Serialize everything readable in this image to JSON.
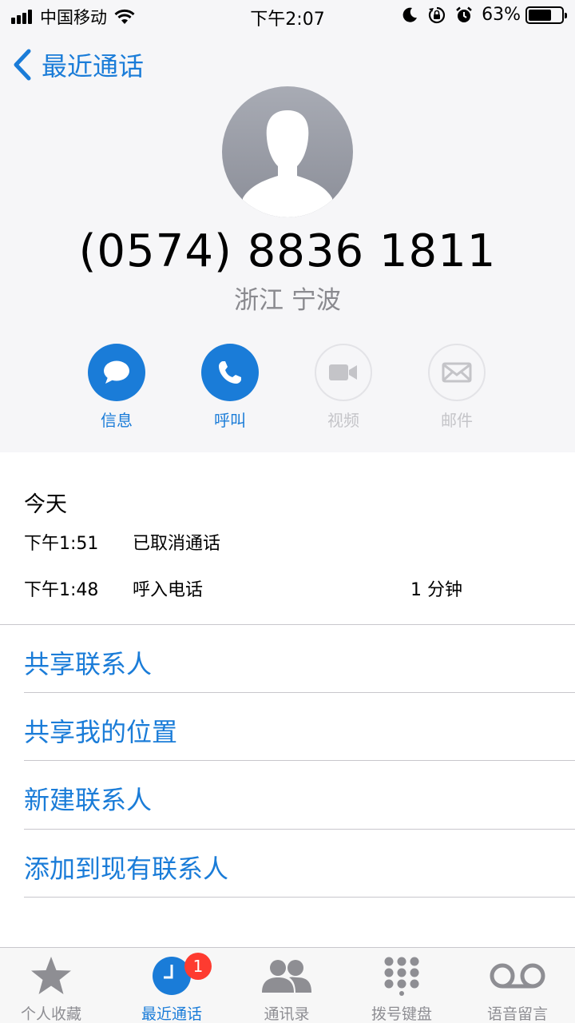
{
  "status_bar": {
    "carrier": "中国移动",
    "time": "下午2:07",
    "battery_percent": "63%"
  },
  "nav": {
    "back_label": "最近通话"
  },
  "contact": {
    "phone_number": "(0574) 8836 1811",
    "location": "浙江 宁波"
  },
  "actions": [
    {
      "label": "信息",
      "enabled": true,
      "icon": "message-icon"
    },
    {
      "label": "呼叫",
      "enabled": true,
      "icon": "phone-icon"
    },
    {
      "label": "视频",
      "enabled": false,
      "icon": "video-icon"
    },
    {
      "label": "邮件",
      "enabled": false,
      "icon": "mail-icon"
    }
  ],
  "history": {
    "date_label": "今天",
    "calls": [
      {
        "time": "下午1:51",
        "type": "已取消通话",
        "duration": ""
      },
      {
        "time": "下午1:48",
        "type": "呼入电话",
        "duration": "1 分钟"
      }
    ]
  },
  "options": [
    "共享联系人",
    "共享我的位置",
    "新建联系人",
    "添加到现有联系人"
  ],
  "tabbar": {
    "tabs": [
      {
        "label": "个人收藏",
        "icon": "star-icon",
        "active": false
      },
      {
        "label": "最近通话",
        "icon": "clock-icon",
        "active": true,
        "badge": "1"
      },
      {
        "label": "通讯录",
        "icon": "contacts-icon",
        "active": false
      },
      {
        "label": "拨号键盘",
        "icon": "keypad-icon",
        "active": false
      },
      {
        "label": "语音留言",
        "icon": "voicemail-icon",
        "active": false
      }
    ]
  },
  "colors": {
    "accent": "#1a7cd8",
    "badge": "#fe3b30",
    "header_bg": "#f6f6f8"
  }
}
